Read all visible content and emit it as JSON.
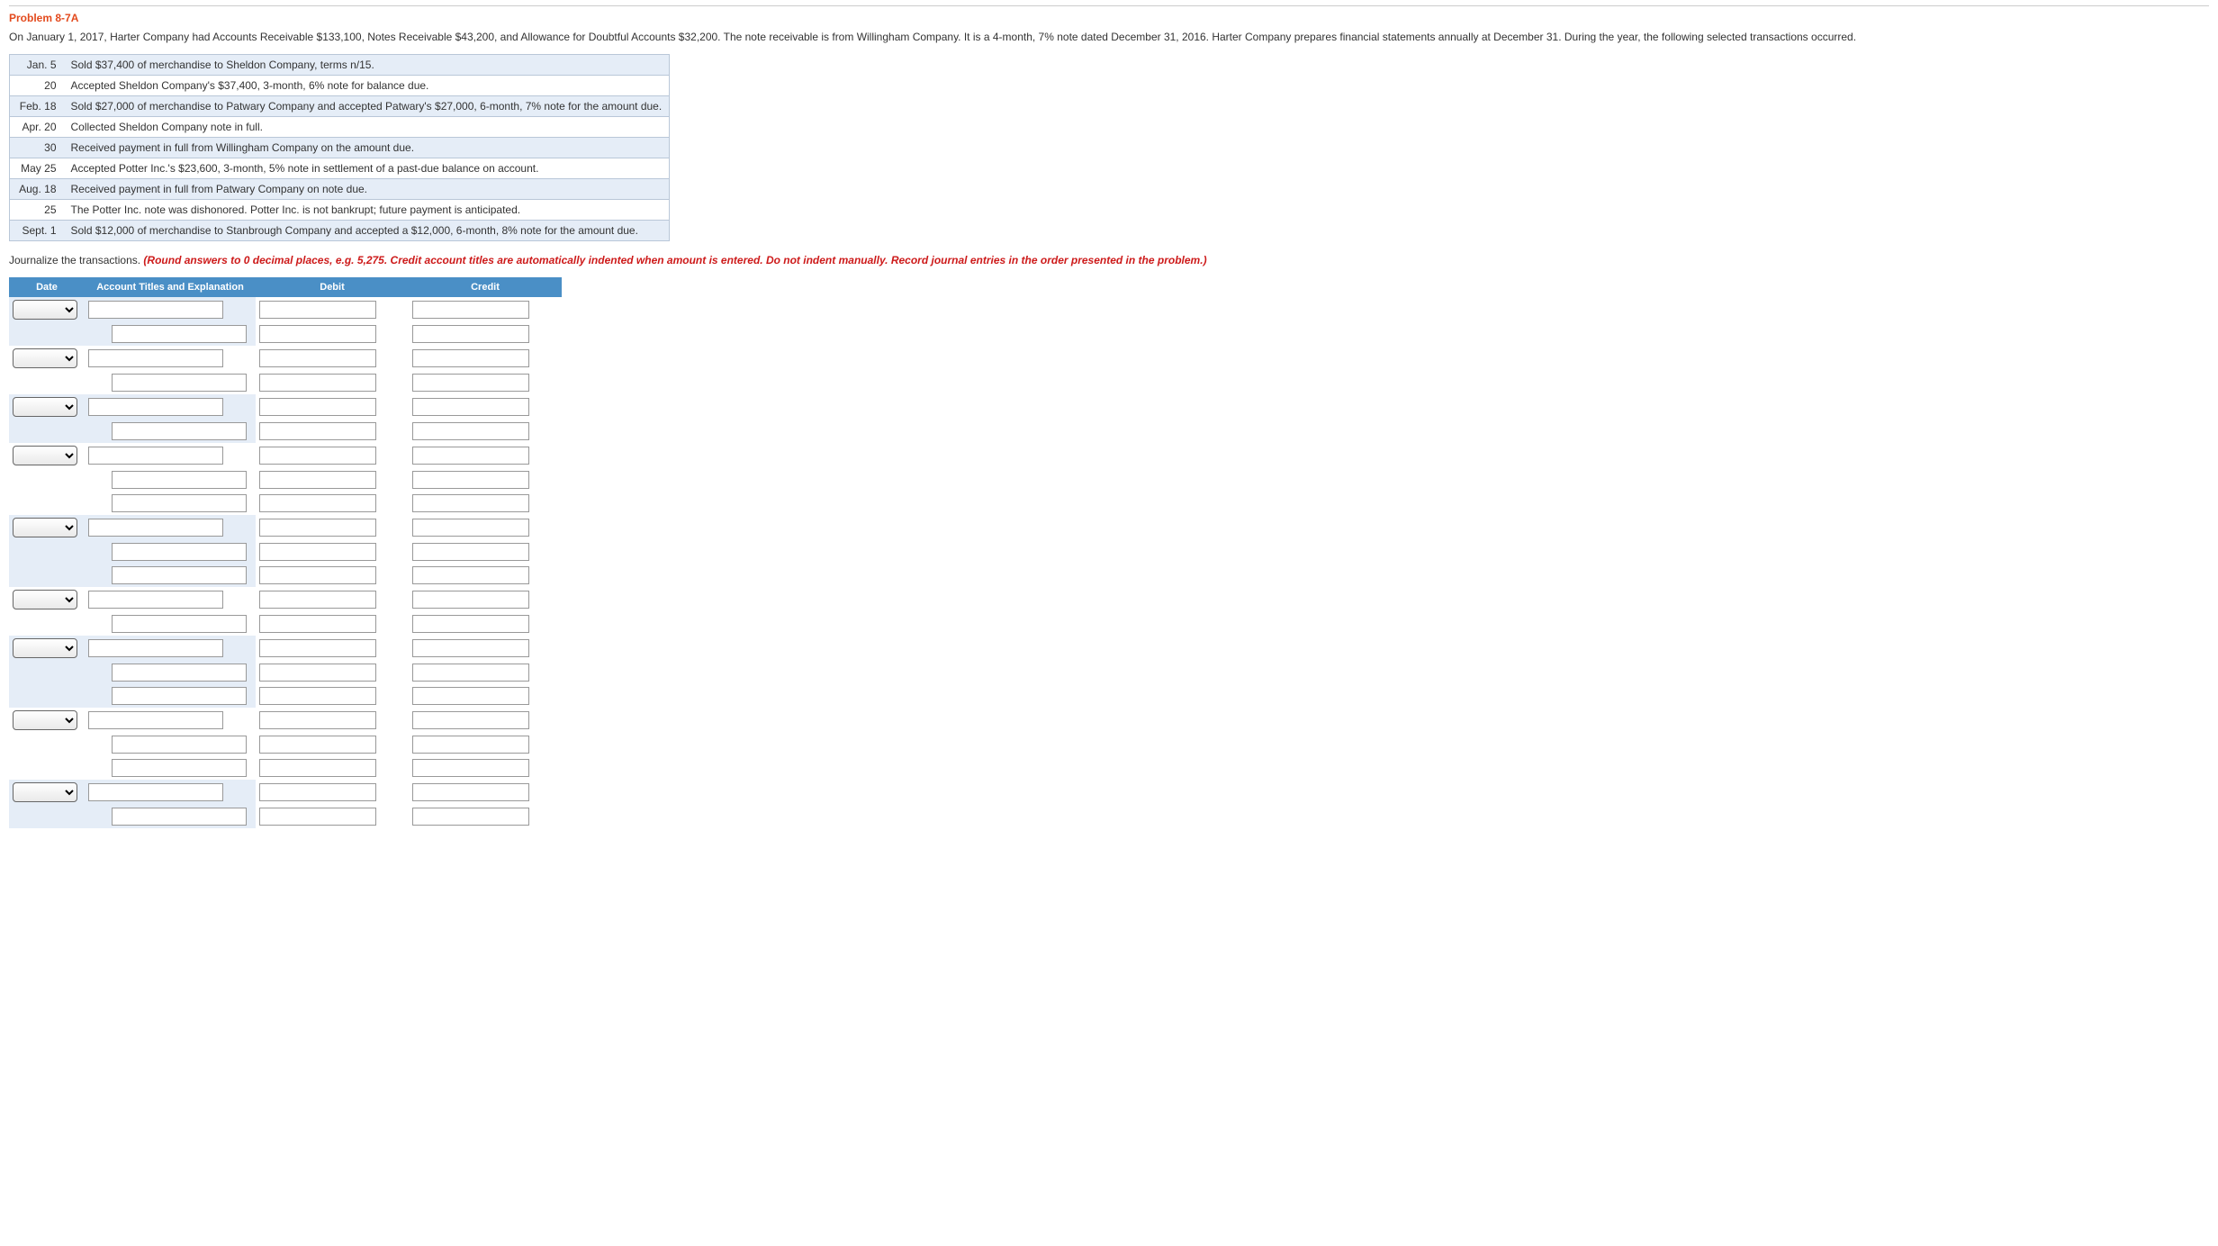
{
  "problem_title": "Problem 8-7A",
  "intro": "On January 1, 2017, Harter Company had Accounts Receivable $133,100, Notes Receivable $43,200, and Allowance for Doubtful Accounts $32,200. The note receivable is from Willingham Company. It is a 4-month, 7% note dated December 31, 2016. Harter Company prepares financial statements annually at December 31. During the year, the following selected transactions occurred.",
  "transactions": [
    {
      "date": "Jan. 5",
      "desc": "Sold $37,400 of merchandise to Sheldon Company, terms n/15."
    },
    {
      "date": "20",
      "desc": "Accepted Sheldon Company's $37,400, 3-month, 6% note for balance due."
    },
    {
      "date": "Feb. 18",
      "desc": "Sold $27,000 of merchandise to Patwary Company and accepted Patwary's $27,000, 6-month, 7% note for the amount due."
    },
    {
      "date": "Apr. 20",
      "desc": "Collected Sheldon Company note in full."
    },
    {
      "date": "30",
      "desc": "Received payment in full from Willingham Company on the amount due."
    },
    {
      "date": "May 25",
      "desc": "Accepted Potter Inc.'s $23,600, 3-month, 5% note in settlement of a past-due balance on account."
    },
    {
      "date": "Aug. 18",
      "desc": "Received payment in full from Patwary Company on note due."
    },
    {
      "date": "25",
      "desc": "The Potter Inc. note was dishonored. Potter Inc. is not bankrupt; future payment is anticipated."
    },
    {
      "date": "Sept. 1",
      "desc": "Sold $12,000 of merchandise to Stanbrough Company and accepted a $12,000, 6-month, 8% note for the amount due."
    }
  ],
  "journalize": {
    "lead": "Journalize the transactions. ",
    "hint": "(Round answers to 0 decimal places, e.g. 5,275. Credit account titles are automatically indented when amount is entered. Do not indent manually. Record journal entries in the order presented in the problem.)"
  },
  "journal_headers": {
    "date": "Date",
    "acct": "Account Titles and Explanation",
    "debit": "Debit",
    "credit": "Credit"
  },
  "journal_groups": [
    2,
    2,
    2,
    3,
    3,
    2,
    3,
    3,
    2
  ]
}
